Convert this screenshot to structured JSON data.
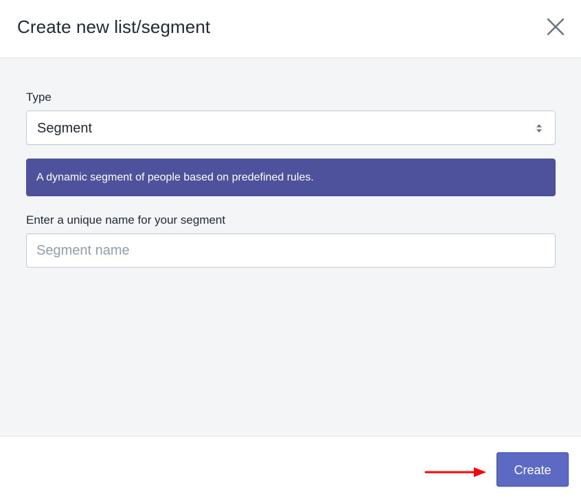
{
  "dialog": {
    "title": "Create new list/segment",
    "close_icon": "close-icon"
  },
  "form": {
    "type_label": "Type",
    "type_value": "Segment",
    "type_arrows_icon": "select-arrows-icon",
    "info_text": "A dynamic segment of people based on predefined rules.",
    "name_label": "Enter a unique name for your segment",
    "name_value": "",
    "name_placeholder": "Segment name"
  },
  "footer": {
    "create_label": "Create",
    "annotation_arrow_icon": "red-arrow-icon"
  },
  "colors": {
    "banner_bg": "#4e519c",
    "primary_button": "#5c6ac4",
    "body_bg": "#f4f5f7",
    "annotation_arrow": "#ff0000"
  }
}
